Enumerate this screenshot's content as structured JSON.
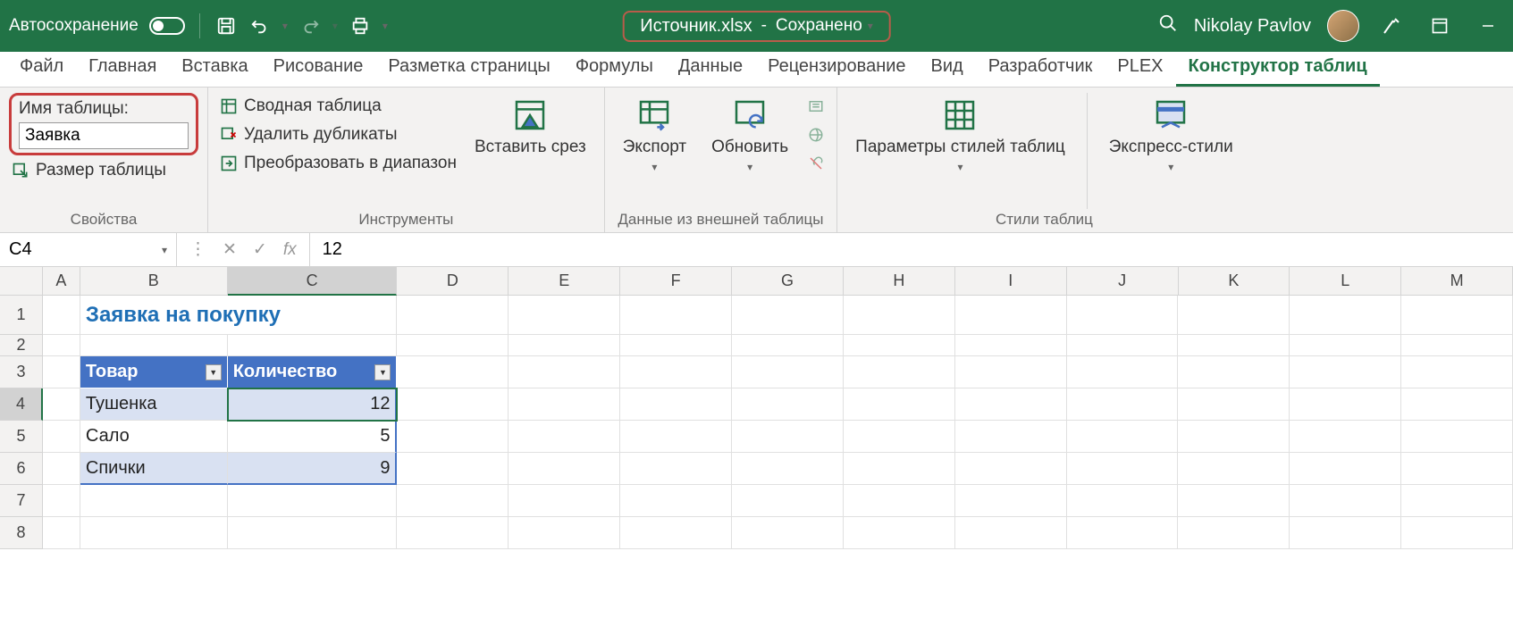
{
  "titlebar": {
    "autosave": "Автосохранение",
    "filename": "Источник.xlsx",
    "saved": "Сохранено",
    "user": "Nikolay Pavlov"
  },
  "tabs": {
    "file": "Файл",
    "home": "Главная",
    "insert": "Вставка",
    "draw": "Рисование",
    "pagelayout": "Разметка страницы",
    "formulas": "Формулы",
    "data": "Данные",
    "review": "Рецензирование",
    "view": "Вид",
    "developer": "Разработчик",
    "plex": "PLEX",
    "tabledesign": "Конструктор таблиц"
  },
  "ribbon": {
    "properties": {
      "namelabel": "Имя таблицы:",
      "namevalue": "Заявка",
      "resize": "Размер таблицы",
      "group": "Свойства"
    },
    "tools": {
      "pivot": "Сводная таблица",
      "removedup": "Удалить дубликаты",
      "convert": "Преобразовать в диапазон",
      "slicer": "Вставить срез",
      "group": "Инструменты"
    },
    "external": {
      "export": "Экспорт",
      "refresh": "Обновить",
      "group": "Данные из внешней таблицы"
    },
    "styleopts": {
      "options": "Параметры стилей таблиц",
      "styles": "Экспресс-стили",
      "group": "Стили таблиц"
    }
  },
  "formulabar": {
    "namebox": "C4",
    "value": "12"
  },
  "columns": [
    "A",
    "B",
    "C",
    "D",
    "E",
    "F",
    "G",
    "H",
    "I",
    "J",
    "K",
    "L",
    "M"
  ],
  "rows": [
    "1",
    "2",
    "3",
    "4",
    "5",
    "6",
    "7",
    "8"
  ],
  "sheet": {
    "title": "Заявка на покупку",
    "header1": "Товар",
    "header2": "Количество",
    "data": [
      {
        "name": "Тушенка",
        "qty": "12"
      },
      {
        "name": "Сало",
        "qty": "5"
      },
      {
        "name": "Спички",
        "qty": "9"
      }
    ]
  }
}
